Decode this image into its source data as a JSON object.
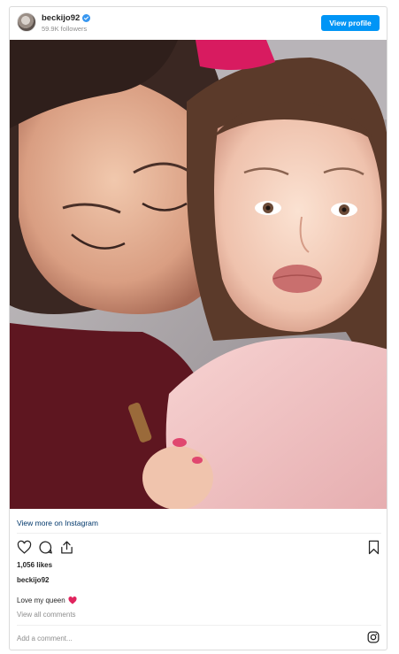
{
  "post": {
    "username": "beckijo92",
    "followers": "59.9K followers",
    "view_profile_label": "View profile",
    "view_more_label": "View more on Instagram",
    "likes": "1,056 likes",
    "caption_user": "beckijo92",
    "caption_text": "Love my queen",
    "caption_emoji": "red-heart-emoji",
    "view_all_comments": "View all comments",
    "add_comment_placeholder": "Add a comment..."
  },
  "colors": {
    "accent": "#0095f6",
    "link": "#00376b",
    "muted": "#8e8e8e",
    "border": "#dbdbdb"
  },
  "icons": {
    "verified": "verified-badge-icon",
    "like": "heart-outline-icon",
    "comment": "comment-bubble-icon",
    "share": "share-icon",
    "save": "bookmark-icon",
    "brand": "instagram-icon"
  }
}
